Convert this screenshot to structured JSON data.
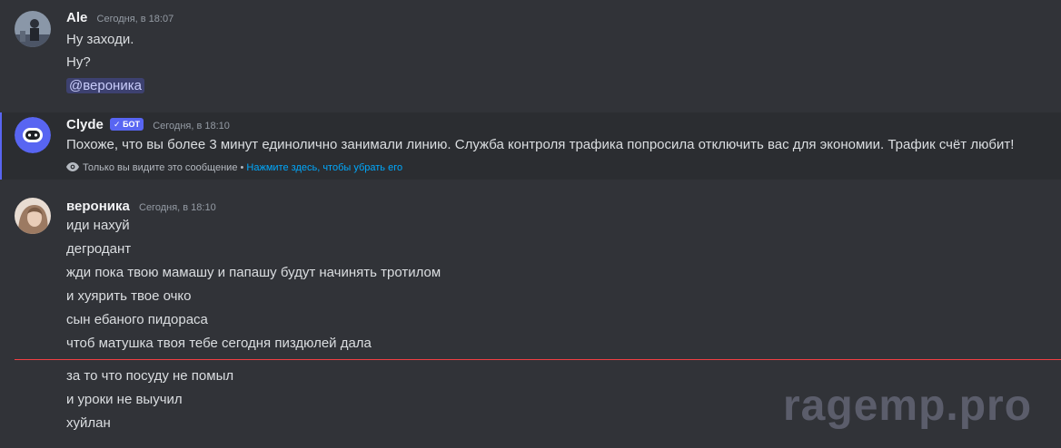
{
  "messages": {
    "ale": {
      "username": "Ale",
      "timestamp": "Сегодня, в 18:07",
      "lines": [
        "Ну заходи.",
        "Ну?"
      ],
      "mention": "@вероника"
    },
    "clyde": {
      "username": "Clyde",
      "bot_badge": "✓ БОТ",
      "timestamp": "Сегодня, в 18:10",
      "text": "Похоже, что вы более 3 минут единолично занимали линию. Служба контроля трафика попросила отключить вас для экономии. Трафик счёт любит!",
      "ephemeral_note": "Только вы видите это сообщение •",
      "dismiss_link": "Нажмите здесь, чтобы убрать его"
    },
    "veronika": {
      "username": "вероника",
      "timestamp": "Сегодня, в 18:10",
      "lines": [
        "иди нахуй",
        "дегродант",
        "жди пока твою мамашу и папашу будут начинять тротилом",
        "и хуярить твое очко",
        "сын ебаного пидораса",
        "чтоб матушка твоя тебе сегодня пиздюлей дала"
      ],
      "new_lines": [
        "за то что посуду не помыл",
        "и уроки не выучил",
        "хуйлан"
      ]
    }
  },
  "watermark": "ragemp.pro",
  "colors": {
    "background": "#313338",
    "ephemeral_background": "#2b2d31",
    "accent": "#5865f2",
    "new_messages_divider": "#f23f43",
    "link": "#00a8fc"
  },
  "icons": {
    "ephemeral": "eye-icon",
    "bot_verified": "check-icon"
  }
}
